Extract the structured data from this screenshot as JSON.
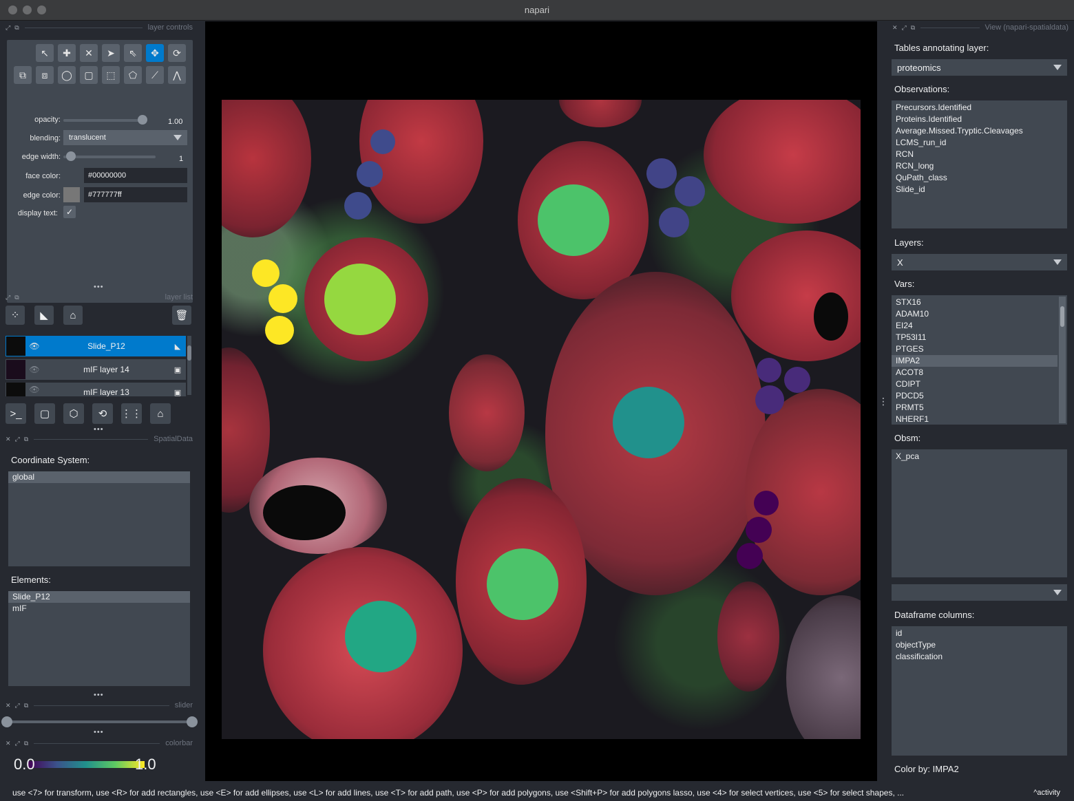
{
  "window": {
    "title": "napari"
  },
  "layer_controls": {
    "header": "layer controls",
    "opacity_label": "opacity:",
    "opacity_value": "1.00",
    "opacity": 1.0,
    "blending_label": "blending:",
    "blending_value": "translucent",
    "edge_width_label": "edge width:",
    "edge_width_value": "1",
    "face_color_label": "face color:",
    "face_color_value": "#00000000",
    "edge_color_label": "edge color:",
    "edge_color_value": "#777777ff",
    "display_text_label": "display text:",
    "display_text_checked": true
  },
  "layer_list": {
    "header": "layer list",
    "layers": [
      {
        "name": "Slide_P12",
        "visible": true,
        "selected": true,
        "type_icon": "shapes-icon"
      },
      {
        "name": "mIF layer 14",
        "visible": false,
        "selected": false,
        "type_icon": "image-icon"
      },
      {
        "name": "mIF layer 13",
        "visible": false,
        "selected": false,
        "type_icon": "image-icon"
      }
    ]
  },
  "spatialdata": {
    "header": "SpatialData",
    "coord_title": "Coordinate System:",
    "coord_items": [
      "global"
    ],
    "elements_title": "Elements:",
    "elements_items": [
      "Slide_P12",
      "mIF"
    ]
  },
  "slider": {
    "header": "slider"
  },
  "colorbar": {
    "header": "colorbar",
    "min_label": "0.0",
    "max_label": "1.0"
  },
  "view_panel": {
    "header": "View (napari-spatialdata)",
    "tables_title": "Tables annotating layer:",
    "tables_value": "proteomics",
    "observations_title": "Observations:",
    "observations": [
      "Precursors.Identified",
      "Proteins.Identified",
      "Average.Missed.Tryptic.Cleavages",
      "LCMS_run_id",
      "RCN",
      "RCN_long",
      "QuPath_class",
      "Slide_id"
    ],
    "layers_title": "Layers:",
    "layers_value": "X",
    "vars_title": "Vars:",
    "vars": [
      "STX16",
      "ADAM10",
      "EI24",
      "TP53I11",
      "PTGES",
      "IMPA2",
      "ACOT8",
      "CDIPT",
      "PDCD5",
      "PRMT5",
      "NHERF1"
    ],
    "vars_selected": "IMPA2",
    "obsm_title": "Obsm:",
    "obsm": [
      "X_pca"
    ],
    "df_combo_value": "",
    "df_title": "Dataframe columns:",
    "df_columns": [
      "id",
      "objectType",
      "classification"
    ],
    "color_by": "Color by: IMPA2"
  },
  "status": {
    "message": "use <7> for transform, use <R> for add rectangles, use <E> for add ellipses, use <L> for add lines, use <T> for add path, use <P> for add polygons, use <Shift+P> for add polygons lasso, use <4> for select vertices, use <5> for select shapes, ...",
    "activity": "activity"
  },
  "colors": {
    "accent": "#007acc",
    "bg": "#262930",
    "panel": "#414851"
  },
  "shapes": [
    {
      "value": 0.35,
      "color": "#3f4b8c"
    },
    {
      "value": 0.35,
      "color": "#3f4b8c"
    },
    {
      "value": 0.35,
      "color": "#3f4b8c"
    },
    {
      "value": 0.75,
      "color": "#4cc36a"
    },
    {
      "value": 0.3,
      "color": "#414487"
    },
    {
      "value": 0.3,
      "color": "#414487"
    },
    {
      "value": 0.3,
      "color": "#414487"
    },
    {
      "value": 0.98,
      "color": "#fde725"
    },
    {
      "value": 0.98,
      "color": "#fde725"
    },
    {
      "value": 0.98,
      "color": "#fde725"
    },
    {
      "value": 0.87,
      "color": "#95d840"
    },
    {
      "value": 0.2,
      "color": "#482b7a"
    },
    {
      "value": 0.2,
      "color": "#482b7a"
    },
    {
      "value": 0.2,
      "color": "#482b7a"
    },
    {
      "value": 0.52,
      "color": "#21918c"
    },
    {
      "value": 0.05,
      "color": "#440154"
    },
    {
      "value": 0.05,
      "color": "#440154"
    },
    {
      "value": 0.05,
      "color": "#440154"
    },
    {
      "value": 0.75,
      "color": "#4cc36a"
    },
    {
      "value": 0.6,
      "color": "#22a784"
    }
  ]
}
